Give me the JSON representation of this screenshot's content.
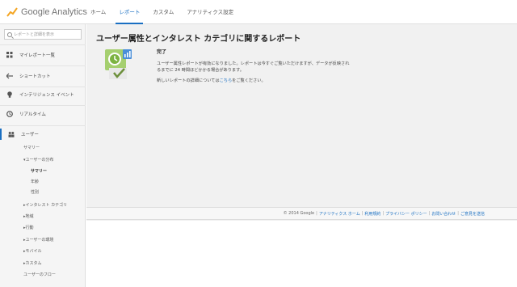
{
  "app": {
    "brand": "Google Analytics"
  },
  "nav": {
    "items": [
      "ホーム",
      "レポート",
      "カスタム",
      "アナリティクス設定"
    ],
    "active_index": 1
  },
  "sidebar": {
    "search_placeholder": "レポートと詳細を表示",
    "items": [
      {
        "label": "マイレポート一覧",
        "icon": "grid-icon"
      },
      {
        "label": "ショートカット",
        "icon": "arrow-left-icon"
      },
      {
        "label": "インテリジェンス イベント",
        "icon": "bulb-icon"
      },
      {
        "label": "リアルタイム",
        "icon": "clock-icon"
      },
      {
        "label": "ユーザー",
        "icon": "users-icon"
      }
    ],
    "audience": {
      "summary": "サマリー",
      "demographics": "▾ユーザーの分布",
      "demo_summary": "サマリー",
      "age": "年齢",
      "gender": "性別",
      "interests": "▸インタレスト カテゴリ",
      "geo": "▸地域",
      "behavior": "▸行動",
      "technology": "▸ユーザーの環境",
      "mobile": "▸モバイル",
      "custom": "▸カスタム",
      "flow": "ユーザーのフロー"
    }
  },
  "main": {
    "title": "ユーザー属性とインタレスト カテゴリに関するレポート",
    "status_title": "完了",
    "body_line1": "ユーザー属性レポートが有効になりました。レポートは今すぐご覧いただけますが、データが反映され",
    "body_line2": "るまでに 24 時間ほどかかる場合があります。",
    "more_prefix": "新しいレポートの詳細については",
    "more_link": "こちら",
    "more_suffix": "をご覧ください。"
  },
  "footer": {
    "copyright": "© 2014 Google",
    "links": [
      "アナリティクス ホーム",
      "利用規約",
      "プライバシー ポリシー",
      "お問い合わせ",
      "ご意見を送信"
    ]
  },
  "colors": {
    "accent": "#1a6fc2",
    "illustration_green": "#7cb342",
    "illustration_blue": "#4a8fd9"
  }
}
